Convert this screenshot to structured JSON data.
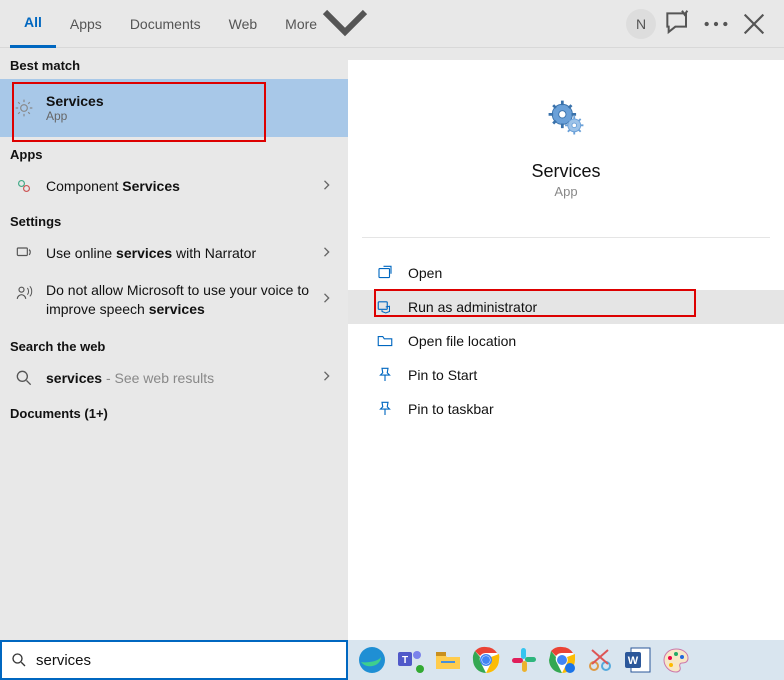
{
  "top": {
    "tabs": [
      "All",
      "Apps",
      "Documents",
      "Web",
      "More"
    ],
    "avatar_initial": "N"
  },
  "left": {
    "best_match_label": "Best match",
    "best_match": {
      "title": "Services",
      "subtitle": "App"
    },
    "apps_label": "Apps",
    "apps": [
      {
        "pre": "Component ",
        "bold": "Services",
        "post": ""
      }
    ],
    "settings_label": "Settings",
    "settings": [
      {
        "pre": "Use online ",
        "bold": "services",
        "post": " with Narrator"
      },
      {
        "pre": "Do not allow Microsoft to use your voice to improve speech ",
        "bold": "services",
        "post": ""
      }
    ],
    "web_label": "Search the web",
    "web": [
      {
        "pre": "",
        "bold": "services",
        "post": " ",
        "suffix": "- See web results"
      }
    ],
    "docs_label": "Documents (1+)"
  },
  "right": {
    "title": "Services",
    "subtitle": "App",
    "actions": [
      "Open",
      "Run as administrator",
      "Open file location",
      "Pin to Start",
      "Pin to taskbar"
    ]
  },
  "search": {
    "value": "services"
  }
}
